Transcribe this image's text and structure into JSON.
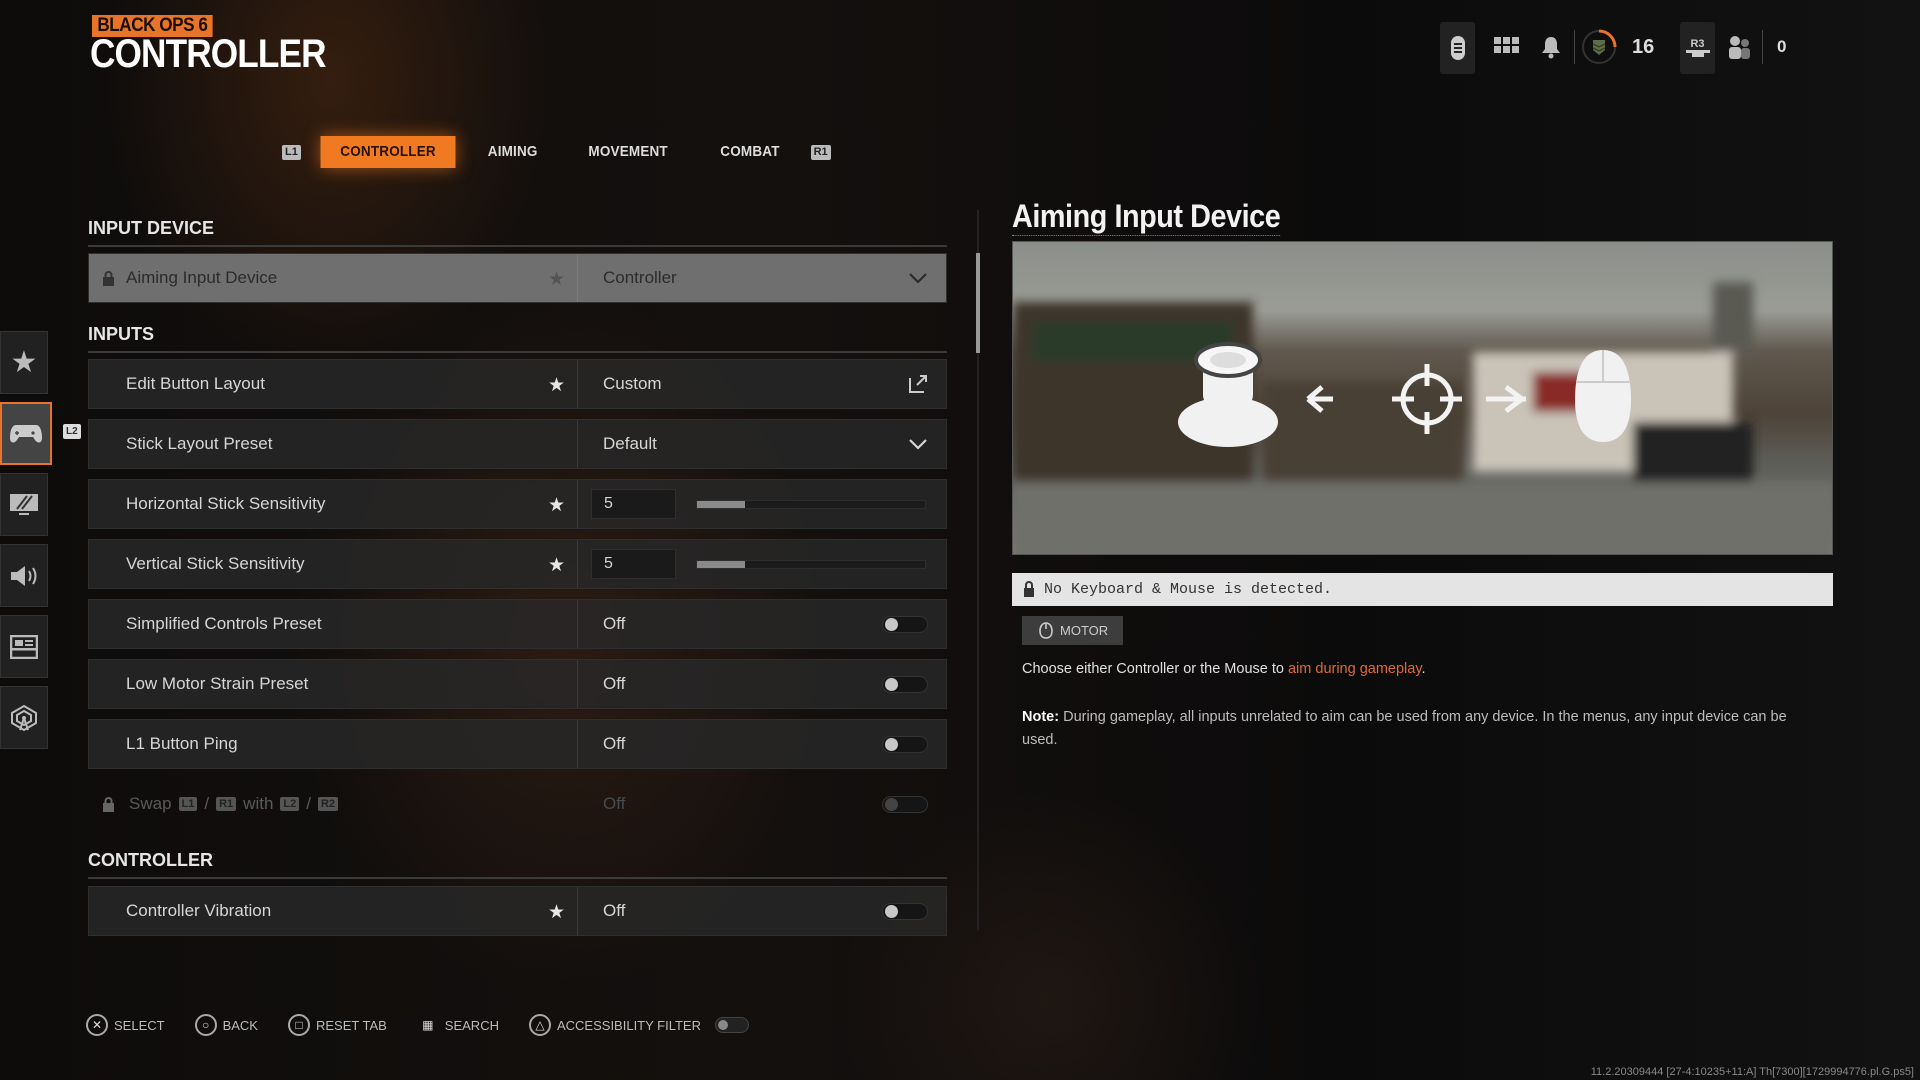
{
  "header": {
    "logo_text": "BLACK OPS 6",
    "title": "CONTROLLER"
  },
  "tabs": {
    "left_bumper": "L1",
    "right_bumper": "R1",
    "items": [
      {
        "label": "CONTROLLER",
        "active": true
      },
      {
        "label": "AIMING"
      },
      {
        "label": "MOVEMENT"
      },
      {
        "label": "COMBAT"
      }
    ]
  },
  "topbar": {
    "level": "16",
    "party_button": "R3",
    "friends_count": "0",
    "rank_progress": 0.25,
    "accent": "#f07a22"
  },
  "sidebar": {
    "items": [
      {
        "icon": "star-icon"
      },
      {
        "icon": "gamepad-icon",
        "active": true
      },
      {
        "icon": "display-icon"
      },
      {
        "icon": "speaker-icon"
      },
      {
        "icon": "interface-icon"
      },
      {
        "icon": "network-icon"
      }
    ],
    "badge": "L2"
  },
  "sections": {
    "input_device": "INPUT DEVICE",
    "inputs": "INPUTS",
    "controller": "CONTROLLER"
  },
  "rows": [
    {
      "label": "Aiming Input Device",
      "value": "Controller",
      "type": "dropdown",
      "locked": true,
      "star": true,
      "selected": true
    },
    {
      "label": "Edit Button Layout",
      "value": "Custom",
      "type": "link",
      "star": true
    },
    {
      "label": "Stick Layout Preset",
      "value": "Default",
      "type": "dropdown"
    },
    {
      "label": "Horizontal Stick Sensitivity",
      "value": "5",
      "type": "slider",
      "fill": 0.21,
      "star": true
    },
    {
      "label": "Vertical Stick Sensitivity",
      "value": "5",
      "type": "slider",
      "fill": 0.21,
      "star": true
    },
    {
      "label": "Simplified Controls Preset",
      "value": "Off",
      "type": "toggle"
    },
    {
      "label": "Low Motor Strain Preset",
      "value": "Off",
      "type": "toggle"
    },
    {
      "label": "L1 Button Ping",
      "value": "Off",
      "type": "toggle"
    },
    {
      "label_parts": [
        "Swap",
        "L1",
        "/",
        "R1",
        "with",
        "L2",
        "/",
        "R2"
      ],
      "value": "Off",
      "type": "toggle",
      "locked": true,
      "disabled": true
    },
    {
      "label": "Controller Vibration",
      "value": "Off",
      "type": "toggle",
      "star": true
    }
  ],
  "detail": {
    "title": "Aiming Input Device",
    "banner": "No Keyboard & Mouse is detected.",
    "tag": "MOTOR",
    "desc_pre": "Choose either Controller or the Mouse to ",
    "desc_highlight": "aim during gameplay",
    "desc_post": ".",
    "note_label": "Note:",
    "note_text": " During gameplay, all inputs unrelated to aim can be used from any device. In the menus, any input device can be used.",
    "highlight_color": "#e06a36"
  },
  "footer": {
    "items": [
      {
        "icon": "cross-button-icon",
        "glyph": "✕",
        "label": "SELECT"
      },
      {
        "icon": "circle-button-icon",
        "glyph": "○",
        "label": "BACK"
      },
      {
        "icon": "square-button-icon",
        "glyph": "□",
        "label": "RESET TAB"
      },
      {
        "icon": "touchpad-icon",
        "glyph": "▦",
        "label": "SEARCH"
      },
      {
        "icon": "triangle-button-icon",
        "glyph": "△",
        "label": "ACCESSIBILITY FILTER"
      }
    ],
    "accessibility_filter_on": false,
    "version": "11.2.20309444 [27-4:10235+11:A] Th[7300][1729994776.pl.G.ps5]"
  }
}
